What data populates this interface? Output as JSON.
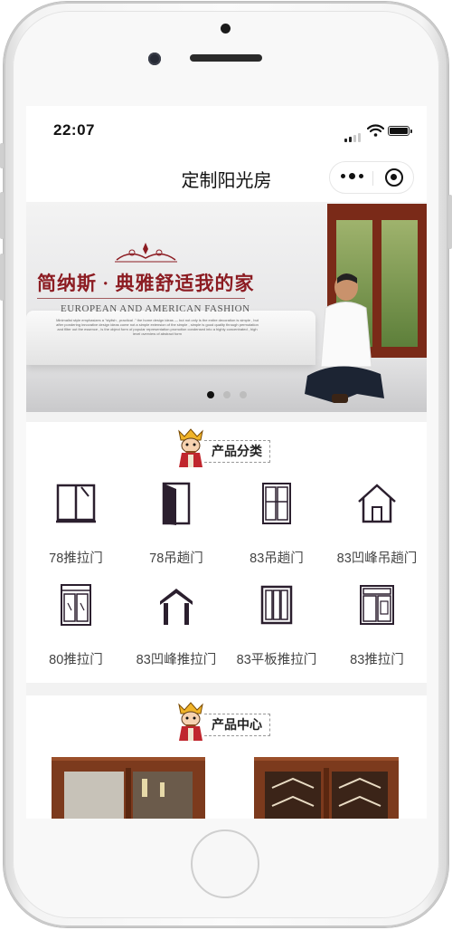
{
  "status": {
    "time": "22:07"
  },
  "nav": {
    "title": "定制阳光房"
  },
  "banner": {
    "cn_slogan": "简纳斯 · 典雅舒适我的家",
    "en_slogan": "EUROPEAN AND AMERICAN FASHION",
    "fine_print": "Minimalist style emphasizes a \"stylish , practical .\" the home design ideas — but not only is the entire decoration is simple , but after pondering innovative design ideas come not a simple extension of the simple , simple is good quality through permutation and filter out the essence , is the object form of popular representation promotion condensed into a highly concentrated , high level overview of abstract form",
    "slide_count": 3,
    "active_slide": 1
  },
  "categories": {
    "header": "产品分类",
    "items": [
      {
        "label": "78推拉门",
        "icon": "sliding-door-78-icon"
      },
      {
        "label": "78吊趟门",
        "icon": "hanging-door-78-icon"
      },
      {
        "label": "83吊趟门",
        "icon": "hanging-door-83-icon"
      },
      {
        "label": "83凹峰吊趟门",
        "icon": "house-icon"
      },
      {
        "label": "80推拉门",
        "icon": "sliding-door-80-icon"
      },
      {
        "label": "83凹峰推拉门",
        "icon": "arch-door-icon"
      },
      {
        "label": "83平板推拉门",
        "icon": "flat-panel-door-icon"
      },
      {
        "label": "83推拉门",
        "icon": "sliding-door-83-icon"
      }
    ]
  },
  "products": {
    "header": "产品中心"
  },
  "colors": {
    "brand_red": "#8c1c22",
    "icon_dark": "#2b1f2e",
    "door_wood": "#7c3a1d"
  }
}
